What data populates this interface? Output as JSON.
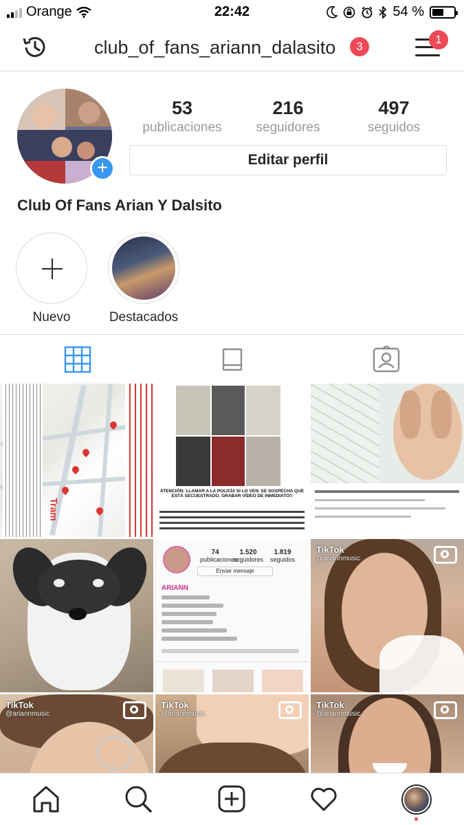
{
  "status_bar": {
    "carrier": "Orange",
    "time": "22:42",
    "battery_percent": "54 %",
    "battery_level": 0.54
  },
  "top_nav": {
    "username": "club_of_fans_ariann_dalasito",
    "notification_count": "3",
    "menu_badge": "1"
  },
  "profile": {
    "stats": [
      {
        "value": "53",
        "label": "publicaciones"
      },
      {
        "value": "216",
        "label": "seguidores"
      },
      {
        "value": "497",
        "label": "seguidos"
      }
    ],
    "edit_button": "Editar perfil",
    "full_name": "Club Of Fans Arian Y Dalsito"
  },
  "highlights": [
    {
      "label": "Nuevo"
    },
    {
      "label": "Destacados"
    }
  ],
  "tabs": [
    {
      "icon": "grid-icon",
      "active": true
    },
    {
      "icon": "feed-icon",
      "active": false
    },
    {
      "icon": "tagged-icon",
      "active": false
    }
  ],
  "posts": [
    {
      "kind": "map",
      "badge": "Tram"
    },
    {
      "kind": "poster",
      "text": "ATENCIÓN: LLAMAR A LA POLICÍA SI LO VEN. SE SOSPECHA QUE ESTÁ SECUESTRADO. GRABAR VÍDEO DE INMEDIATO!!"
    },
    {
      "kind": "video-screenshot"
    },
    {
      "kind": "dog-photo"
    },
    {
      "kind": "profile-screenshot",
      "mini_stats": [
        {
          "value": "74",
          "label": "publicaciones"
        },
        {
          "value": "1.520",
          "label": "seguidores"
        },
        {
          "value": "1.819",
          "label": "seguidos"
        }
      ],
      "mini_button": "Enviar mensaje",
      "mini_name": "ARIANN"
    },
    {
      "kind": "video",
      "tiktok": "TikTok",
      "handle": "@ariannmusic"
    },
    {
      "kind": "video",
      "tiktok": "TikTok",
      "handle": "@ariannmusic"
    },
    {
      "kind": "video",
      "tiktok": "TikTok",
      "handle": "@ariannmusic"
    },
    {
      "kind": "video",
      "tiktok": "TikTok",
      "handle": "@ariannmusic"
    }
  ],
  "bottom_nav": [
    "home-icon",
    "search-icon",
    "add-post-icon",
    "activity-icon",
    "profile-avatar"
  ],
  "colors": {
    "accent_blue": "#3897f0",
    "badge_red": "#ed4956",
    "text": "#262626",
    "muted": "#999999",
    "border": "#dbdbdb"
  }
}
